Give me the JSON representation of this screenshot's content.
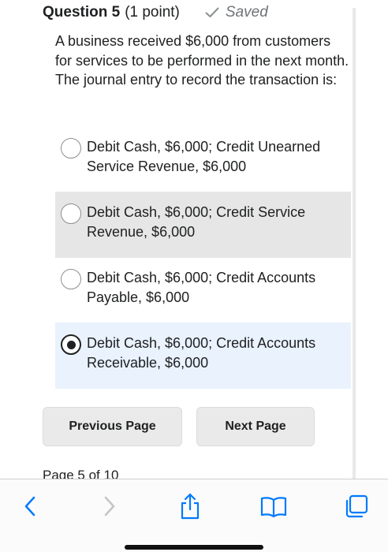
{
  "question": {
    "title": "Question 5",
    "points": "(1 point)",
    "status": "Saved",
    "text": "A business received $6,000 from customers for services to be performed in the next month.  The journal entry to record the transaction is:"
  },
  "options": [
    {
      "label": "Debit Cash, $6,000; Credit Unearned Service Revenue, $6,000",
      "selected": false
    },
    {
      "label": "Debit Cash, $6,000; Credit Service Revenue, $6,000",
      "selected": false
    },
    {
      "label": "Debit Cash, $6,000; Credit Accounts Payable, $6,000",
      "selected": false
    },
    {
      "label": "Debit Cash, $6,000; Credit Accounts Receivable, $6,000",
      "selected": true
    }
  ],
  "navigation": {
    "previous_label": "Previous Page",
    "next_label": "Next Page",
    "page_indicator": "Page 5 of 10"
  },
  "browser_toolbar": {
    "icons": [
      "back-icon",
      "forward-icon",
      "share-icon",
      "bookmarks-icon",
      "tabs-icon"
    ]
  },
  "colors": {
    "accent": "#007aff",
    "selected_background": "#e9f2fd",
    "hover_background": "#e6e6e6"
  }
}
